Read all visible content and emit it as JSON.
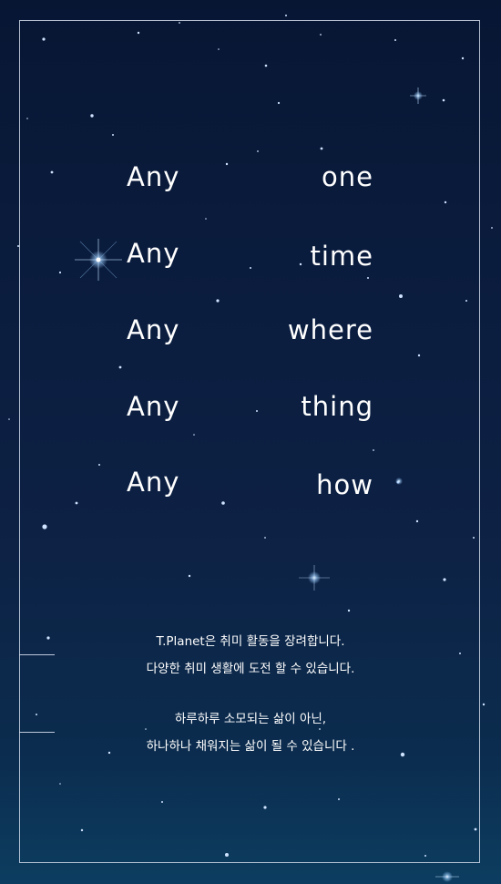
{
  "colors": {
    "background_top": "#071633",
    "background_bottom": "#0c3d60",
    "frame": "#d2dceb",
    "text": "#ffffff"
  },
  "rows": [
    {
      "left": "Any",
      "right": "one"
    },
    {
      "left": "Any",
      "right": "time"
    },
    {
      "left": "Any",
      "right": "where"
    },
    {
      "left": "Any",
      "right": "thing"
    },
    {
      "left": "Any",
      "right": "how"
    }
  ],
  "description": {
    "line1": "T.Planet은 취미 활동을 장려합니다.",
    "line2": "다양한 취미 생활에 도전 할 수 있습니다.",
    "line3": "하루하루 소모되는 삶이 아닌,",
    "line4": "하나하나 채워지는 삶이 될 수 있습니다 ."
  }
}
